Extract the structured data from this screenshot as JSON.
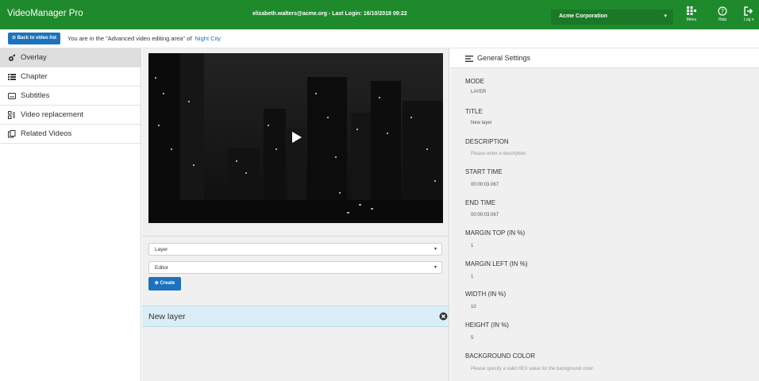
{
  "header": {
    "app_title": "VideoManager Pro",
    "login_info": "elizabeth.walters@acme.org - Last Login: 16/10/2018 09:22",
    "organization": "Acme Corporation",
    "buttons": {
      "menu": "Menu",
      "help": "Help",
      "logout": "Log o"
    }
  },
  "breadcrumb": {
    "back_label": "Back to video list",
    "text": "You are in the \"Advanced video editing area\" of",
    "link": "Night City"
  },
  "sidebar": {
    "items": [
      {
        "label": "Overlay",
        "icon": "overlay-icon",
        "active": true
      },
      {
        "label": "Chapter",
        "icon": "list-icon",
        "active": false
      },
      {
        "label": "Subtitles",
        "icon": "subtitles-icon",
        "active": false
      },
      {
        "label": "Video replacement",
        "icon": "video-replacement-icon",
        "active": false
      },
      {
        "label": "Related Videos",
        "icon": "related-videos-icon",
        "active": false
      }
    ]
  },
  "editor": {
    "type_select": "Layer",
    "editor_select": "Editor",
    "create_label": "Create",
    "layers": [
      {
        "label": "New layer"
      }
    ]
  },
  "settings": {
    "title": "General Settings",
    "fields": [
      {
        "label": "MODE",
        "value": "LAYER",
        "placeholder": false
      },
      {
        "label": "TITLE",
        "value": "New layer",
        "placeholder": false
      },
      {
        "label": "DESCRIPTION",
        "value": "Please enter a description.",
        "placeholder": true
      },
      {
        "label": "START TIME",
        "value": "00:00:03.067",
        "placeholder": false
      },
      {
        "label": "END TIME",
        "value": "00:00:03.067",
        "placeholder": false
      },
      {
        "label": "MARGIN TOP (IN %)",
        "value": "1",
        "placeholder": false
      },
      {
        "label": "MARGIN LEFT (IN %)",
        "value": "1",
        "placeholder": false
      },
      {
        "label": "WIDTH (IN %)",
        "value": "10",
        "placeholder": false
      },
      {
        "label": "HEIGHT (IN %)",
        "value": "5",
        "placeholder": false
      },
      {
        "label": "BACKGROUND COLOR",
        "value": "Please specify a valid HEX value for the background color.",
        "placeholder": true
      }
    ]
  },
  "colors": {
    "brand_green": "#1f8a2c",
    "accent_blue": "#1e72bd",
    "layer_selected": "#dbeef8"
  }
}
